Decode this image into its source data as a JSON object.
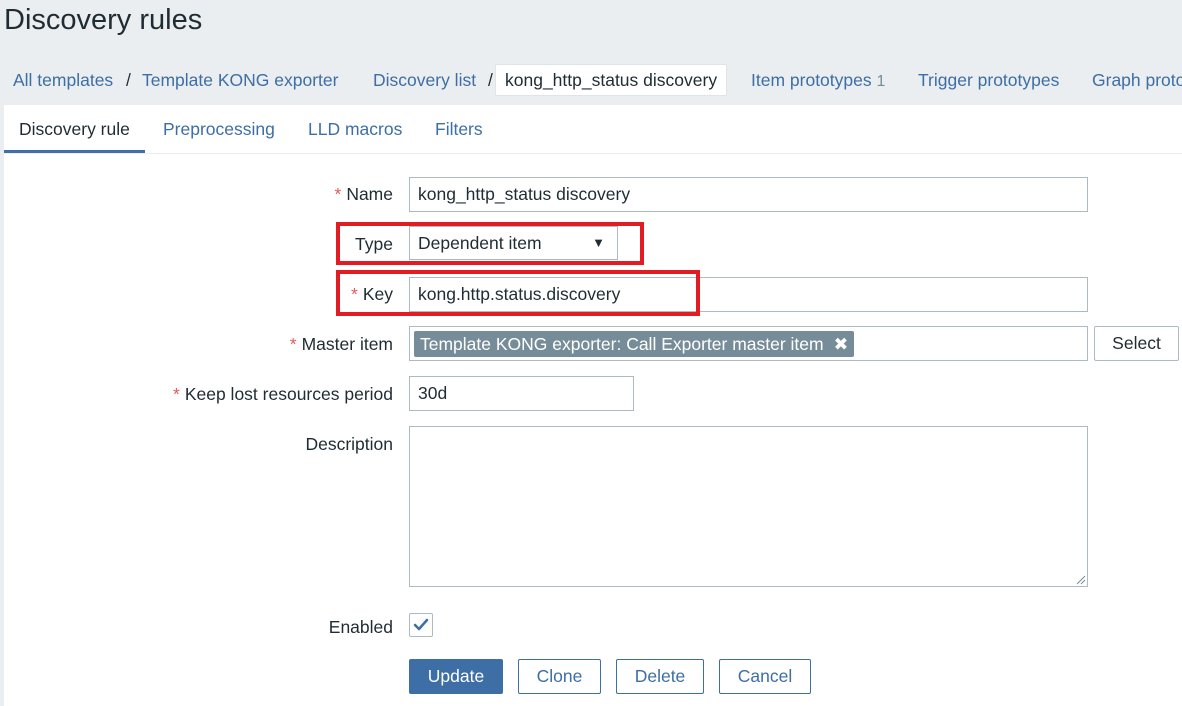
{
  "page": {
    "title": "Discovery rules"
  },
  "breadcrumbs": {
    "all_templates": "All templates",
    "sep1": "/",
    "template": "Template KONG exporter",
    "discovery_list": "Discovery list",
    "sep2": "/",
    "current": "kong_http_status discovery",
    "item_prototypes": "Item prototypes",
    "item_prototypes_count": "1",
    "trigger_prototypes": "Trigger prototypes",
    "graph_prototypes": "Graph prototypes"
  },
  "tabs": {
    "discovery_rule": "Discovery rule",
    "preprocessing": "Preprocessing",
    "lld_macros": "LLD macros",
    "filters": "Filters"
  },
  "form": {
    "required_mark": "*",
    "name_label": "Name",
    "name_value": "kong_http_status discovery",
    "type_label": "Type",
    "type_value": "Dependent item",
    "type_arrow": "▼",
    "key_label": "Key",
    "key_value": "kong.http.status.discovery",
    "master_item_label": "Master item",
    "master_item_value": "Template KONG exporter: Call Exporter master item",
    "master_item_remove": "✖",
    "select_button": "Select",
    "keep_lost_label": "Keep lost resources period",
    "keep_lost_value": "30d",
    "description_label": "Description",
    "description_value": "",
    "enabled_label": "Enabled",
    "enabled": true,
    "checkmark": "✔"
  },
  "buttons": {
    "update": "Update",
    "clone": "Clone",
    "delete": "Delete",
    "cancel": "Cancel"
  },
  "colors": {
    "accent": "#3d6ea5",
    "highlight": "#e31b23",
    "required": "#e45959"
  }
}
